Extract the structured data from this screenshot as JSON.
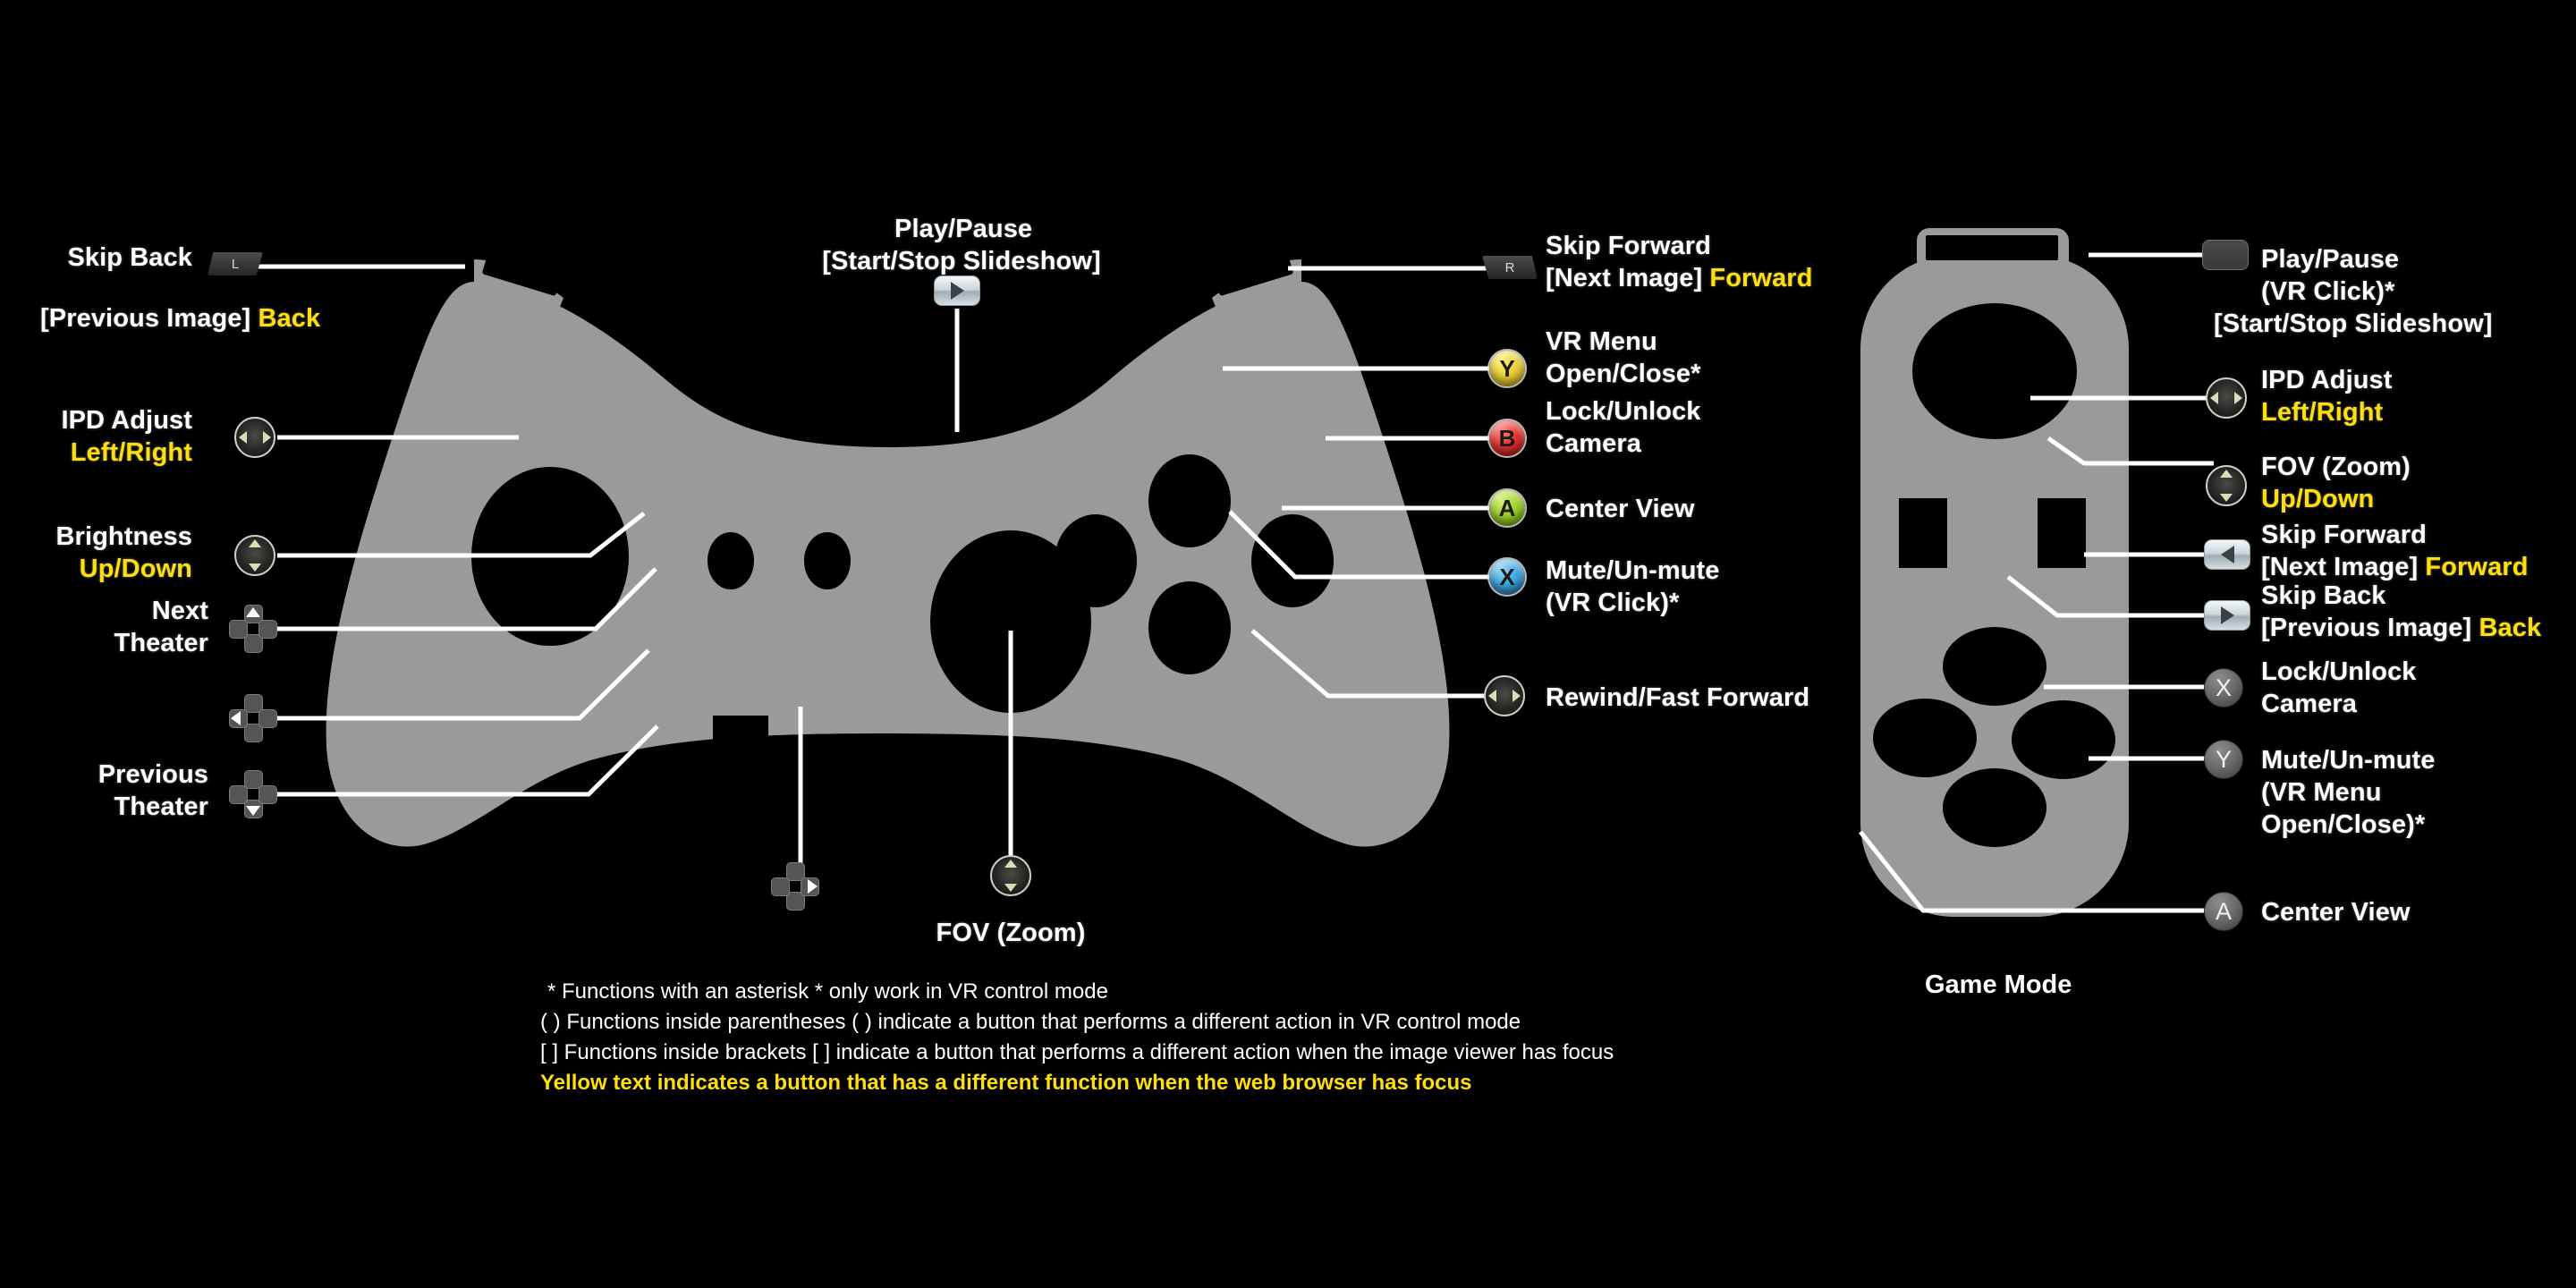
{
  "colors": {
    "background": "#000000",
    "controller_body": "#9a9a9a",
    "highlight_yellow": "#ffdf0a",
    "text_white": "#ffffff",
    "button_y": "#ecd13a",
    "button_b": "#e8352f",
    "button_a": "#9ed32c",
    "button_x": "#3fa9e0",
    "line_color": "#ffffff"
  },
  "left_labels": [
    {
      "id": "skip-back",
      "l1": "Skip Back",
      "l2": "[Previous Image] ",
      "l2y": "Back"
    },
    {
      "id": "ipd-adjust",
      "l1": "IPD Adjust",
      "l1y": "Left/Right"
    },
    {
      "id": "brightness",
      "l1": "Brightness",
      "l1y": "Up/Down"
    },
    {
      "id": "next-theater",
      "l1": "Next",
      "l2": "Theater"
    },
    {
      "id": "previous-theater",
      "l1": "Previous",
      "l2": "Theater"
    }
  ],
  "top_center": {
    "line1": "Play/Pause",
    "line2": "[Start/Stop Slideshow]"
  },
  "bottom_center": {
    "fov": "FOV (Zoom)"
  },
  "right_labels": [
    {
      "id": "skip-forward",
      "l1": "Skip Forward",
      "l2": "[Next Image] ",
      "l2y": "Forward"
    },
    {
      "id": "vr-menu",
      "btn": "Y",
      "l1": "VR Menu",
      "l2": "Open/Close*"
    },
    {
      "id": "lock-camera",
      "btn": "B",
      "l1": "Lock/Unlock",
      "l2": "Camera"
    },
    {
      "id": "center-view",
      "btn": "A",
      "l1": "Center View"
    },
    {
      "id": "mute",
      "btn": "X",
      "l1": "Mute/Un-mute",
      "l2": "(VR Click)*"
    },
    {
      "id": "rewind-ff",
      "l1": "Rewind/Fast Forward"
    }
  ],
  "game_mode": {
    "caption": "Game Mode",
    "items": [
      {
        "id": "gm-play-pause",
        "l1": "Play/Pause",
        "l2": "(VR Click)*",
        "l3": "[Start/Stop Slideshow]"
      },
      {
        "id": "gm-ipd-adjust",
        "l1": "IPD Adjust",
        "l1y": "Left/Right"
      },
      {
        "id": "gm-fov",
        "l1": "FOV (Zoom)",
        "l1y": "Up/Down"
      },
      {
        "id": "gm-skip-forward",
        "l1": "Skip Forward",
        "l2": "[Next Image] ",
        "l2y": "Forward"
      },
      {
        "id": "gm-skip-back",
        "l1": "Skip Back",
        "l2": "[Previous Image] ",
        "l2y": "Back"
      },
      {
        "id": "gm-lock-camera",
        "btn": "X",
        "l1": "Lock/Unlock",
        "l2": "Camera"
      },
      {
        "id": "gm-mute",
        "btn": "Y",
        "l1": "Mute/Un-mute",
        "l2": "(VR Menu",
        "l3": "Open/Close)*"
      },
      {
        "id": "gm-center-view",
        "btn": "A",
        "l1": "Center View"
      }
    ]
  },
  "bumpers": {
    "left": "L",
    "right": "R"
  },
  "footer": {
    "line1": "*  Functions with an asterisk * only work in VR control mode",
    "line2": "( ) Functions inside parentheses ( ) indicate a button that performs a different action in VR control mode",
    "line3": "[ ] Functions inside brackets [ ] indicate a button that performs a different action when the image viewer has focus",
    "line4": "Yellow text indicates a button that has a different function when the web browser has focus"
  }
}
